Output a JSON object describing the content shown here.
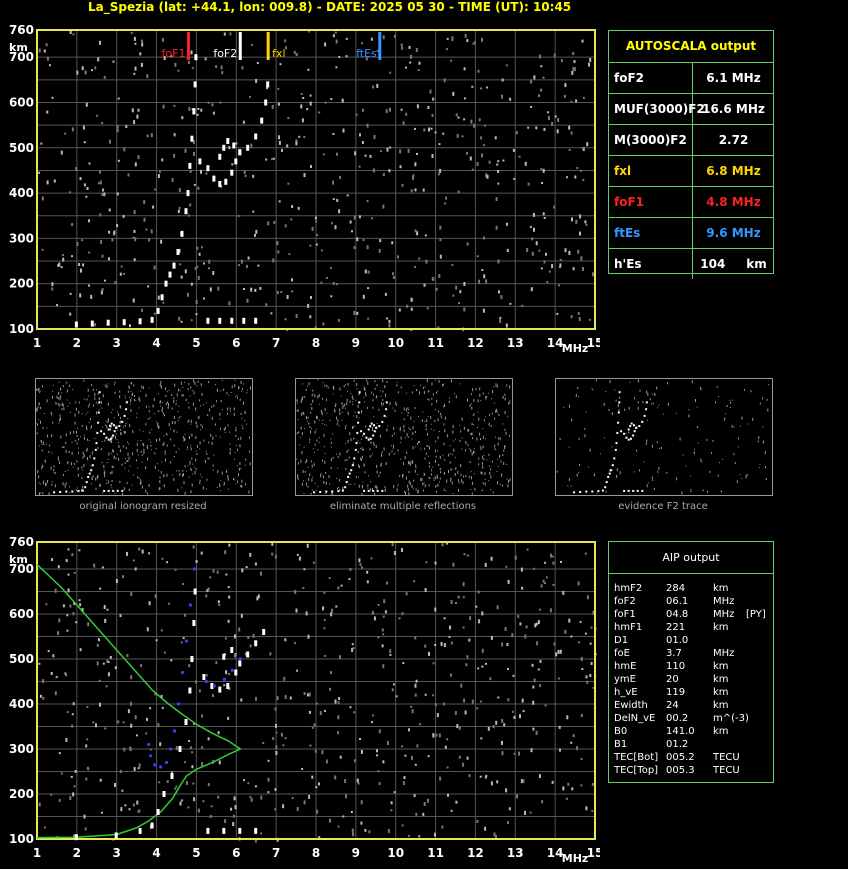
{
  "header": "La_Spezia (lat: +44.1, lon: 009.8) - DATE: 2025 05 30 - TIME (UT): 10:45",
  "colors": {
    "frame": "#e6e659",
    "grid": "#555555",
    "trace": "#ffffff",
    "fof1": "#ff2020",
    "fof2": "#ffffff",
    "fxl": "#ffd700",
    "ftes": "#3399ff",
    "profile": "#33cc33",
    "aip_trace": "#3344ff"
  },
  "chart_data": [
    {
      "type": "scatter",
      "name": "ionogram",
      "xlabel": "MHz",
      "ylabel": "km",
      "xlim": [
        1,
        15
      ],
      "ylim": [
        100,
        760
      ],
      "xticks": [
        "1",
        "2",
        "3",
        "4",
        "5",
        "6",
        "7",
        "8",
        "9",
        "10",
        "11",
        "12",
        "13",
        "14",
        "15"
      ],
      "yticks": [
        "100",
        "200",
        "300",
        "400",
        "500",
        "600",
        "700",
        "760"
      ],
      "markers": [
        {
          "label": "foF1",
          "x": 4.8,
          "color": "#ff2020"
        },
        {
          "label": "foF2",
          "x": 6.1,
          "color": "#ffffff"
        },
        {
          "label": "fxl",
          "x": 6.8,
          "color": "#ffd700"
        },
        {
          "label": "ftEs",
          "x": 9.6,
          "color": "#3399ff"
        }
      ],
      "trace": [
        [
          2.0,
          110
        ],
        [
          2.4,
          112
        ],
        [
          2.8,
          114
        ],
        [
          3.2,
          115
        ],
        [
          3.6,
          117
        ],
        [
          3.9,
          120
        ],
        [
          4.05,
          140
        ],
        [
          4.15,
          170
        ],
        [
          4.25,
          200
        ],
        [
          4.35,
          220
        ],
        [
          4.45,
          240
        ],
        [
          4.55,
          270
        ],
        [
          4.65,
          310
        ],
        [
          4.75,
          360
        ],
        [
          4.8,
          400
        ],
        [
          4.85,
          460
        ],
        [
          4.9,
          520
        ],
        [
          4.95,
          580
        ],
        [
          4.98,
          640
        ],
        [
          5.0,
          700
        ],
        [
          5.1,
          470
        ],
        [
          5.3,
          455
        ],
        [
          5.45,
          432
        ],
        [
          5.6,
          420
        ],
        [
          5.75,
          425
        ],
        [
          5.9,
          445
        ],
        [
          6.0,
          470
        ],
        [
          6.1,
          490
        ],
        [
          5.6,
          480
        ],
        [
          5.7,
          500
        ],
        [
          5.8,
          515
        ],
        [
          5.95,
          505
        ],
        [
          6.1,
          490
        ],
        [
          6.3,
          500
        ],
        [
          6.5,
          525
        ],
        [
          6.65,
          560
        ],
        [
          6.75,
          600
        ],
        [
          6.8,
          640
        ],
        [
          5.3,
          118
        ],
        [
          5.6,
          118
        ],
        [
          5.9,
          118
        ],
        [
          6.2,
          118
        ],
        [
          6.5,
          118
        ]
      ]
    },
    {
      "type": "line",
      "name": "aip",
      "xlabel": "MHz",
      "ylabel": "km",
      "xlim": [
        1,
        15
      ],
      "ylim": [
        100,
        760
      ],
      "xticks": [
        "1",
        "2",
        "3",
        "4",
        "5",
        "6",
        "7",
        "8",
        "9",
        "10",
        "11",
        "12",
        "13",
        "14",
        "15"
      ],
      "yticks": [
        "100",
        "200",
        "300",
        "400",
        "500",
        "600",
        "700",
        "760"
      ],
      "profile": [
        [
          1.0,
          103
        ],
        [
          2.0,
          104
        ],
        [
          3.0,
          110
        ],
        [
          3.5,
          125
        ],
        [
          3.8,
          140
        ],
        [
          4.1,
          160
        ],
        [
          4.4,
          190
        ],
        [
          4.6,
          220
        ],
        [
          4.75,
          240
        ],
        [
          5.0,
          255
        ],
        [
          5.4,
          270
        ],
        [
          5.8,
          288
        ],
        [
          6.1,
          300
        ],
        [
          5.8,
          318
        ],
        [
          5.4,
          335
        ],
        [
          5.0,
          355
        ],
        [
          4.6,
          380
        ],
        [
          4.3,
          400
        ],
        [
          3.9,
          430
        ],
        [
          3.4,
          480
        ],
        [
          2.8,
          540
        ],
        [
          2.2,
          600
        ],
        [
          1.6,
          660
        ],
        [
          1.0,
          710
        ]
      ],
      "aip_trace": [
        [
          3.8,
          310
        ],
        [
          3.85,
          285
        ],
        [
          3.95,
          265
        ],
        [
          4.1,
          260
        ],
        [
          4.25,
          270
        ],
        [
          4.35,
          300
        ],
        [
          4.45,
          340
        ],
        [
          4.55,
          400
        ],
        [
          4.65,
          470
        ],
        [
          4.75,
          540
        ],
        [
          4.85,
          620
        ],
        [
          4.95,
          700
        ],
        [
          5.25,
          450
        ],
        [
          5.45,
          440
        ],
        [
          5.7,
          455
        ],
        [
          5.9,
          475
        ],
        [
          6.1,
          500
        ]
      ],
      "trace": [
        [
          2.0,
          104
        ],
        [
          3.0,
          108
        ],
        [
          3.6,
          118
        ],
        [
          3.9,
          130
        ],
        [
          4.05,
          160
        ],
        [
          4.2,
          200
        ],
        [
          4.4,
          240
        ],
        [
          4.6,
          300
        ],
        [
          4.75,
          360
        ],
        [
          4.85,
          430
        ],
        [
          4.9,
          500
        ],
        [
          4.95,
          580
        ],
        [
          4.98,
          650
        ],
        [
          5.2,
          460
        ],
        [
          5.4,
          440
        ],
        [
          5.6,
          432
        ],
        [
          5.8,
          440
        ],
        [
          6.0,
          470
        ],
        [
          6.1,
          490
        ],
        [
          5.7,
          505
        ],
        [
          5.9,
          520
        ],
        [
          6.3,
          510
        ],
        [
          6.5,
          535
        ],
        [
          6.7,
          560
        ],
        [
          5.3,
          118
        ],
        [
          5.7,
          118
        ],
        [
          6.1,
          118
        ],
        [
          6.5,
          118
        ]
      ]
    }
  ],
  "autoscala": {
    "title": "AUTOSCALA output",
    "rows": [
      {
        "key": "foF2",
        "value": "6.1 MHz",
        "color": "#ffffff"
      },
      {
        "key": "MUF(3000)F2",
        "value": "16.6 MHz",
        "color": "#ffffff"
      },
      {
        "key": "M(3000)F2",
        "value": "2.72",
        "color": "#ffffff"
      },
      {
        "key": "fxl",
        "value": "6.8 MHz",
        "color": "#ffd700"
      },
      {
        "key": "foF1",
        "value": "4.8 MHz",
        "color": "#ff2020"
      },
      {
        "key": "ftEs",
        "value": "9.6 MHz",
        "color": "#3399ff"
      },
      {
        "key": "h'Es",
        "value": "104     km",
        "color": "#ffffff"
      }
    ]
  },
  "aip": {
    "title": "AIP output",
    "rows": [
      {
        "k": "hmF2",
        "v": "284",
        "u": "km",
        "x": ""
      },
      {
        "k": "foF2",
        "v": "06.1",
        "u": "MHz",
        "x": ""
      },
      {
        "k": "foF1",
        "v": "04.8",
        "u": "MHz",
        "x": "[PY]"
      },
      {
        "k": "hmF1",
        "v": "221",
        "u": "km",
        "x": ""
      },
      {
        "k": "D1",
        "v": "01.0",
        "u": "",
        "x": ""
      },
      {
        "k": "foE",
        "v": "3.7",
        "u": "MHz",
        "x": ""
      },
      {
        "k": "hmE",
        "v": "110",
        "u": "km",
        "x": ""
      },
      {
        "k": "ymE",
        "v": "20",
        "u": "km",
        "x": ""
      },
      {
        "k": "h_vE",
        "v": "119",
        "u": "km",
        "x": ""
      },
      {
        "k": "Ewidth",
        "v": "24",
        "u": "km",
        "x": ""
      },
      {
        "k": "DelN_vE",
        "v": "00.2",
        "u": "m^(-3)",
        "x": ""
      },
      {
        "k": "B0",
        "v": "141.0",
        "u": "km",
        "x": ""
      },
      {
        "k": "B1",
        "v": "01.2",
        "u": "",
        "x": ""
      },
      {
        "k": "TEC[Bot]",
        "v": "005.2",
        "u": "TECU",
        "x": ""
      },
      {
        "k": "TEC[Top]",
        "v": "005.3",
        "u": "TECU",
        "x": ""
      }
    ]
  },
  "thumbnails": [
    {
      "caption": "original ionogram resized"
    },
    {
      "caption": "eliminate multiple reflections"
    },
    {
      "caption": "evidence F2 trace"
    }
  ]
}
